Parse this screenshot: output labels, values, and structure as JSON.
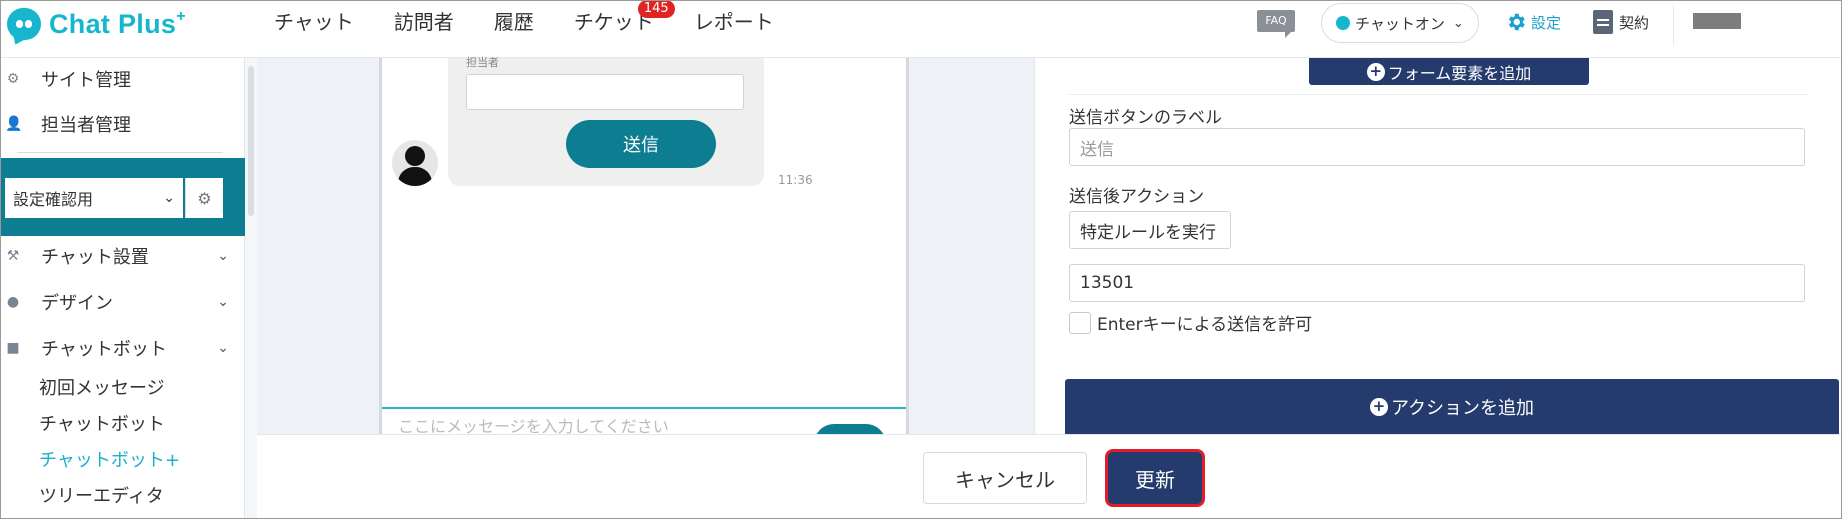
{
  "app": {
    "logo_text": "Chat Plus",
    "logo_sup": "+"
  },
  "header": {
    "nav": [
      {
        "label": "チャット"
      },
      {
        "label": "訪問者"
      },
      {
        "label": "履歴"
      },
      {
        "label": "チケット",
        "badge": "145"
      },
      {
        "label": "レポート"
      }
    ],
    "faq_label": "FAQ",
    "status_label": "チャットオン",
    "settings_label": "設定",
    "contract_label": "契約"
  },
  "sidebar": {
    "top_items": [
      {
        "label": "サイト管理",
        "icon": "gear-icon"
      },
      {
        "label": "担当者管理",
        "icon": "user-gear-icon"
      }
    ],
    "site_select_value": "設定確認用",
    "menu_items": [
      {
        "label": "チャット設置",
        "icon": "tools-icon"
      },
      {
        "label": "デザイン",
        "icon": "palette-icon"
      },
      {
        "label": "チャットボット",
        "icon": "chat-icon"
      }
    ],
    "sub_items": [
      {
        "label": "初回メッセージ"
      },
      {
        "label": "チャットボット"
      },
      {
        "label": "チャットボット+",
        "active": true
      },
      {
        "label": "ツリーエディタ"
      }
    ]
  },
  "preview": {
    "field_label": "担当者",
    "send_label": "送信",
    "time": "11:36",
    "input_placeholder": "ここにメッセージを入力してください"
  },
  "form": {
    "add_form_element_label": "フォーム要素を追加",
    "send_button_label_title": "送信ボタンのラベル",
    "send_button_label_placeholder": "送信",
    "after_send_action_title": "送信後アクション",
    "after_send_action_value": "特定ルールを実行",
    "rule_id_value": "13501",
    "enter_key_label": "Enterキーによる送信を許可",
    "add_action_label": "アクションを追加"
  },
  "footer": {
    "cancel_label": "キャンセル",
    "update_label": "更新"
  },
  "colors": {
    "brand_cyan": "#17b6cf",
    "teal": "#0d7e92",
    "navy": "#253b6e",
    "badge_red": "#e02424",
    "highlight_red": "#e11d2a"
  }
}
